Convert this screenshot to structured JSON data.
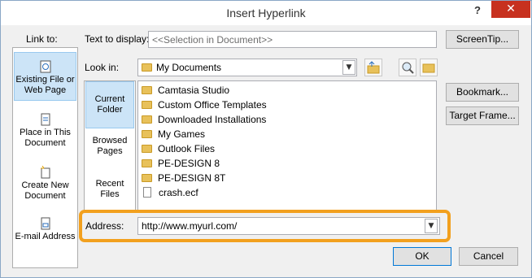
{
  "window": {
    "title": "Insert Hyperlink",
    "help_glyph": "?",
    "close_glyph": "✕"
  },
  "labels": {
    "link_to": "Link to:",
    "text_to_display": "Text to display:",
    "look_in": "Look in:",
    "address": "Address:"
  },
  "text_to_display_value": "<<Selection in Document>>",
  "look_in_value": "My Documents",
  "address_value": "http://www.myurl.com/",
  "link_to_items": [
    {
      "label": "Existing File or Web Page",
      "selected": true
    },
    {
      "label": "Place in This Document",
      "selected": false
    },
    {
      "label": "Create New Document",
      "selected": false
    },
    {
      "label": "E-mail Address",
      "selected": false
    }
  ],
  "look_in_bar": [
    {
      "label": "Current Folder",
      "selected": true
    },
    {
      "label": "Browsed Pages",
      "selected": false
    },
    {
      "label": "Recent Files",
      "selected": false
    }
  ],
  "files": [
    {
      "name": "Camtasia Studio",
      "type": "folder"
    },
    {
      "name": "Custom Office Templates",
      "type": "folder"
    },
    {
      "name": "Downloaded Installations",
      "type": "folder"
    },
    {
      "name": "My Games",
      "type": "folder"
    },
    {
      "name": "Outlook Files",
      "type": "folder"
    },
    {
      "name": "PE-DESIGN 8",
      "type": "folder"
    },
    {
      "name": "PE-DESIGN 8T",
      "type": "folder"
    },
    {
      "name": "crash.ecf",
      "type": "file"
    }
  ],
  "buttons": {
    "screentip": "ScreenTip...",
    "bookmark": "Bookmark...",
    "target_frame": "Target Frame...",
    "ok": "OK",
    "cancel": "Cancel"
  },
  "colors": {
    "highlight": "#f2a01e",
    "selection": "#cce4f7",
    "close": "#c7311f"
  }
}
